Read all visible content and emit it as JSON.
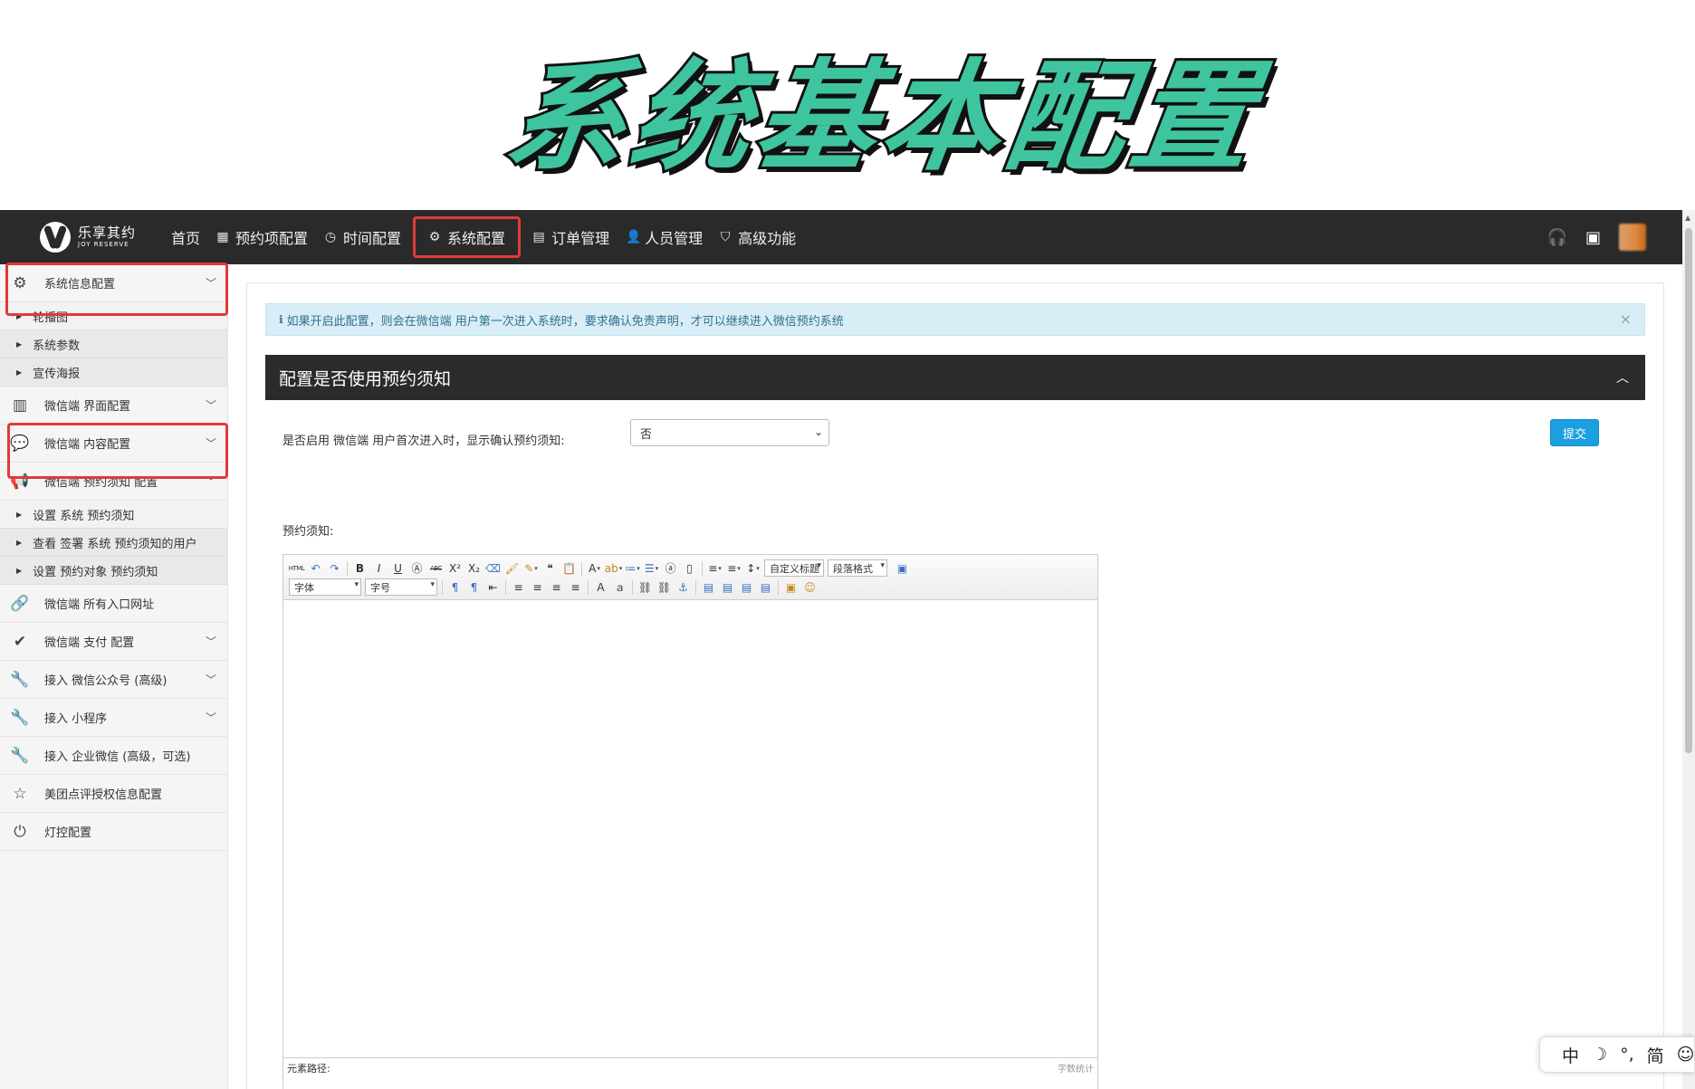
{
  "banner": {
    "title": "系统基本配置"
  },
  "topnav": {
    "logo": {
      "cn": "乐享其约",
      "en": "JOY RESERVE"
    },
    "items": [
      {
        "label": "首页",
        "icon": ""
      },
      {
        "label": "预约项配置",
        "icon": "▦"
      },
      {
        "label": "时间配置",
        "icon": "◷"
      },
      {
        "label": "系统配置",
        "icon": "⚙"
      },
      {
        "label": "订单管理",
        "icon": "▤"
      },
      {
        "label": "人员管理",
        "icon": "👤"
      },
      {
        "label": "高级功能",
        "icon": "⛉"
      }
    ],
    "right_icons": [
      "headset-icon",
      "archive-icon"
    ]
  },
  "sidebar": {
    "group_system_info": {
      "label": "系统信息配置",
      "icon": "⚙"
    },
    "sub_carousel": "轮播图",
    "sub_system_params": "系统参数",
    "sub_promo_poster": "宣传海报",
    "group_ui": {
      "label": "微信端 界面配置",
      "icon": "▥"
    },
    "group_content": {
      "label": "微信端 内容配置",
      "icon": "💬"
    },
    "group_notice": {
      "label": "微信端 预约须知 配置",
      "icon": "📢"
    },
    "sub_set_notice": "设置 系统 预约须知",
    "sub_view_signed": "查看 签署 系统 预约须知的用户",
    "sub_set_object_notice": "设置 预约对象 预约须知",
    "group_entry_urls": {
      "label": "微信端 所有入口网址",
      "icon": "🔗"
    },
    "group_payment": {
      "label": "微信端 支付 配置",
      "icon": "✔"
    },
    "group_official_account": {
      "label": "接入 微信公众号 (高级)",
      "icon": "🔧"
    },
    "group_miniprogram": {
      "label": "接入 小程序",
      "icon": "🔧"
    },
    "group_wecom": {
      "label": "接入 企业微信 (高级，可选)",
      "icon": "🔧"
    },
    "group_meituan": {
      "label": "美团点评授权信息配置",
      "icon": "☆"
    },
    "group_light": {
      "label": "灯控配置",
      "icon": "⏻"
    }
  },
  "content": {
    "alert": "如果开启此配置，则会在微信端 用户第一次进入系统时，要求确认免责声明，才可以继续进入微信预约系统",
    "panel_title": "配置是否使用预约须知",
    "enable_label": "是否启用 微信端 用户首次进入时，显示确认预约须知:",
    "enable_value": "否",
    "submit_label": "提交",
    "notice_label": "预约须知:"
  },
  "editor": {
    "row1_before_combos": [
      "HTML",
      "↶",
      "↷",
      "|",
      "B",
      "I",
      "U",
      "A",
      "ABC",
      "X²",
      "X₂",
      "⌫",
      "🖌",
      "✎",
      "❝❞",
      "📋",
      "|",
      "A",
      "ab",
      "≔",
      "⁝≡",
      "ⓐ",
      "▯",
      "|",
      "≡",
      "≡",
      "↕"
    ],
    "combo_custom_title": "自定义标题",
    "combo_paragraph": "段落格式",
    "combo_font": "字体",
    "combo_size": "字号",
    "row2_tools": [
      "¶",
      "¶",
      "⇤",
      "|",
      "≡",
      "≡",
      "≡",
      "≡",
      "|",
      "A",
      "A",
      "|",
      "⛓",
      "⛓",
      "⚓",
      "|",
      "▤",
      "▤",
      "▤",
      "▤",
      "|",
      "▣",
      "☺"
    ],
    "status_path": "元素路径:",
    "status_count": "字数统计"
  },
  "ime": [
    "中",
    "☽",
    "°,",
    "简",
    "☺"
  ]
}
